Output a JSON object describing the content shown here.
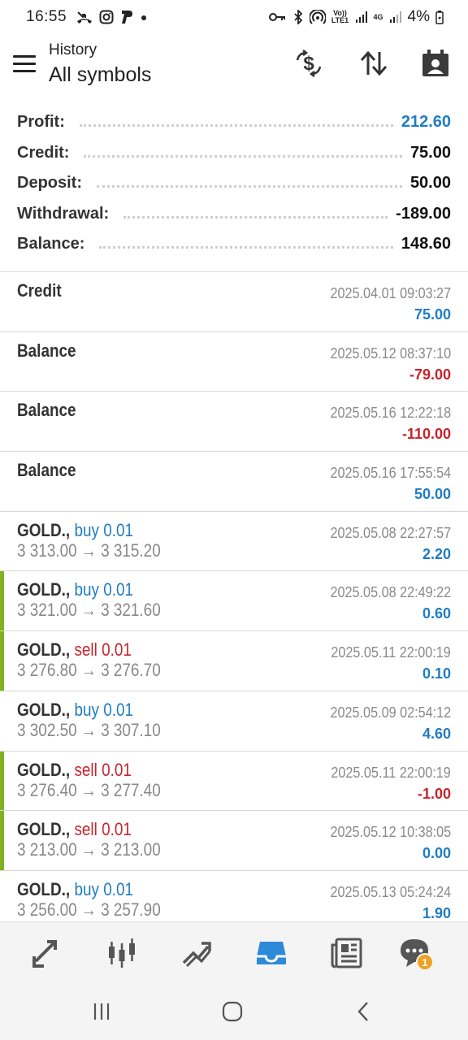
{
  "status_bar": {
    "time": "16:55",
    "lte_label": "Vo)) LTE1",
    "net_label": "4G",
    "battery": "4%"
  },
  "header": {
    "subtitle": "History",
    "title": "All symbols"
  },
  "summary": [
    {
      "label": "Profit:",
      "value": "212.60",
      "highlight": true
    },
    {
      "label": "Credit:",
      "value": "75.00",
      "highlight": false
    },
    {
      "label": "Deposit:",
      "value": "50.00",
      "highlight": false
    },
    {
      "label": "Withdrawal:",
      "value": "-189.00",
      "highlight": false
    },
    {
      "label": "Balance:",
      "value": "148.60",
      "highlight": false
    }
  ],
  "history": [
    {
      "name": "Credit",
      "side": "",
      "prices": "",
      "datetime": "2025.04.01 09:03:27",
      "amount": "75.00",
      "sign": "pos",
      "marked": false
    },
    {
      "name": "Balance",
      "side": "",
      "prices": "",
      "datetime": "2025.05.12 08:37:10",
      "amount": "-79.00",
      "sign": "neg",
      "marked": false
    },
    {
      "name": "Balance",
      "side": "",
      "prices": "",
      "datetime": "2025.05.16 12:22:18",
      "amount": "-110.00",
      "sign": "neg",
      "marked": false
    },
    {
      "name": "Balance",
      "side": "",
      "prices": "",
      "datetime": "2025.05.16 17:55:54",
      "amount": "50.00",
      "sign": "pos",
      "marked": false
    },
    {
      "name": "GOLD.,",
      "side": "buy 0.01",
      "side_type": "buy",
      "prices": "3 313.00 → 3 315.20",
      "datetime": "2025.05.08 22:27:57",
      "amount": "2.20",
      "sign": "pos",
      "marked": false
    },
    {
      "name": "GOLD.,",
      "side": "buy 0.01",
      "side_type": "buy",
      "prices": "3 321.00 → 3 321.60",
      "datetime": "2025.05.08 22:49:22",
      "amount": "0.60",
      "sign": "pos",
      "marked": true
    },
    {
      "name": "GOLD.,",
      "side": "sell 0.01",
      "side_type": "sell",
      "prices": "3 276.80 → 3 276.70",
      "datetime": "2025.05.11 22:00:19",
      "amount": "0.10",
      "sign": "pos",
      "marked": true
    },
    {
      "name": "GOLD.,",
      "side": "buy 0.01",
      "side_type": "buy",
      "prices": "3 302.50 → 3 307.10",
      "datetime": "2025.05.09 02:54:12",
      "amount": "4.60",
      "sign": "pos",
      "marked": false
    },
    {
      "name": "GOLD.,",
      "side": "sell 0.01",
      "side_type": "sell",
      "prices": "3 276.40 → 3 277.40",
      "datetime": "2025.05.11 22:00:19",
      "amount": "-1.00",
      "sign": "neg",
      "marked": true
    },
    {
      "name": "GOLD.,",
      "side": "sell 0.01",
      "side_type": "sell",
      "prices": "3 213.00 → 3 213.00",
      "datetime": "2025.05.12 10:38:05",
      "amount": "0.00",
      "sign": "pos",
      "marked": true
    },
    {
      "name": "GOLD.,",
      "side": "buy 0.01",
      "side_type": "buy",
      "prices": "3 256.00 → 3 257.90",
      "datetime": "2025.05.13 05:24:24",
      "amount": "1.90",
      "sign": "pos",
      "marked": false
    }
  ],
  "bottom_nav": {
    "items": [
      "quotes-icon",
      "chart-icon",
      "trade-icon",
      "history-icon",
      "news-icon",
      "chat-icon"
    ],
    "active": "history-icon",
    "chat_badge": "1"
  },
  "colors": {
    "accent": "#1f7cc3",
    "negative": "#c8232a",
    "marker": "#7fb21e"
  }
}
